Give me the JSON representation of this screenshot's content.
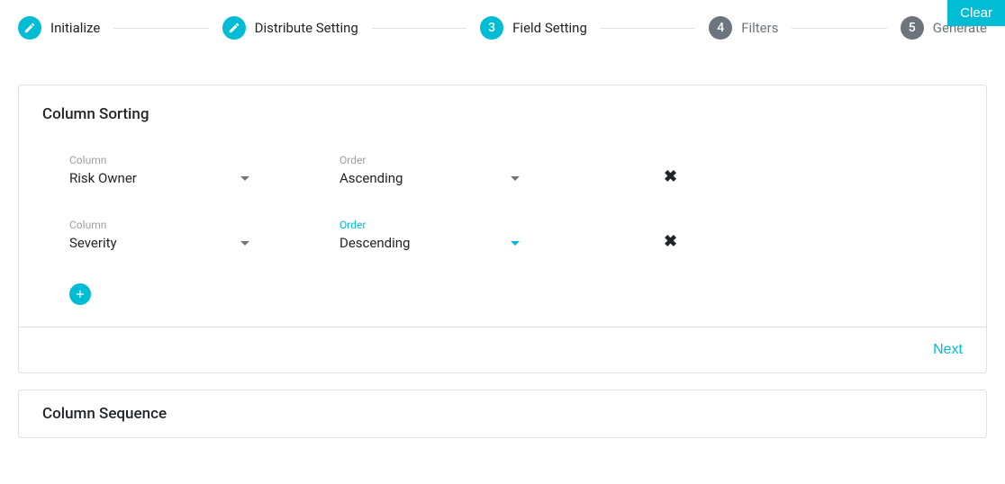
{
  "clear_label": "Clear",
  "stepper": {
    "steps": [
      {
        "label": "Initialize",
        "badge": "",
        "state": "done"
      },
      {
        "label": "Distribute Setting",
        "badge": "",
        "state": "done"
      },
      {
        "label": "Field Setting",
        "badge": "3",
        "state": "current"
      },
      {
        "label": "Filters",
        "badge": "4",
        "state": "future"
      },
      {
        "label": "Generate",
        "badge": "5",
        "state": "future"
      }
    ]
  },
  "card1": {
    "title": "Column Sorting",
    "rows": [
      {
        "column_label": "Column",
        "column_value": "Risk Owner",
        "order_label": "Order",
        "order_value": "Ascending",
        "focused": false
      },
      {
        "column_label": "Column",
        "column_value": "Severity",
        "order_label": "Order",
        "order_value": "Descending",
        "focused": true
      }
    ],
    "next_label": "Next"
  },
  "card2": {
    "title": "Column Sequence"
  }
}
